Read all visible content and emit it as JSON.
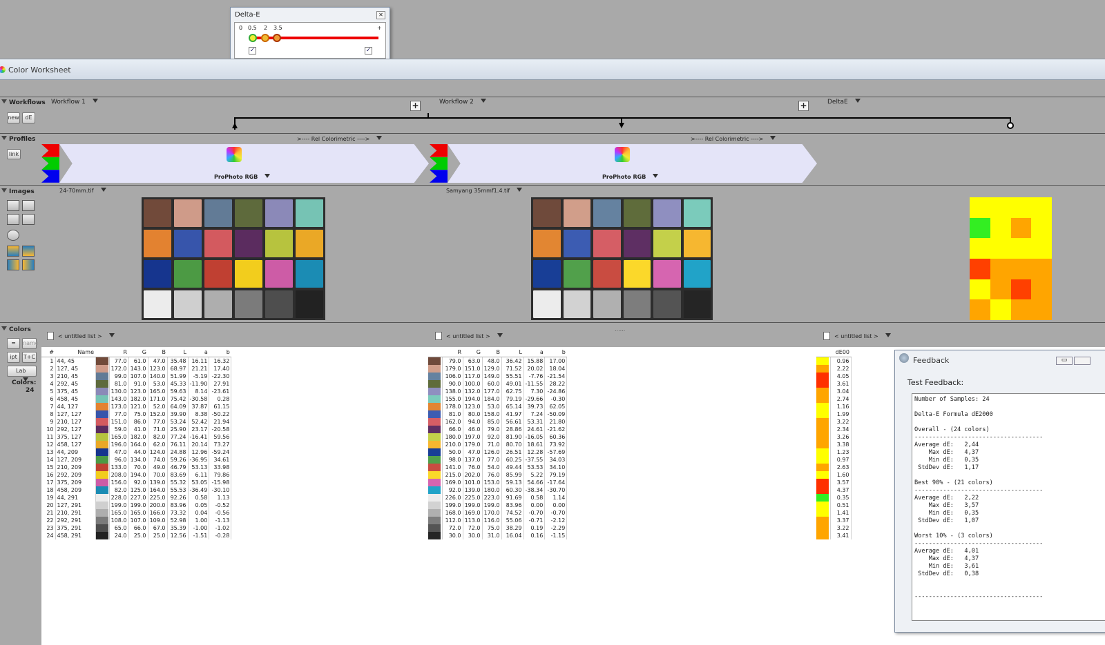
{
  "deltaE_window": {
    "title": "Delta-E",
    "scale": [
      "0",
      "0.5",
      "2",
      "3.5",
      "+"
    ],
    "check1": true,
    "check2": true
  },
  "window": {
    "title": "Color Worksheet"
  },
  "workflows": {
    "section": "Workflows",
    "new_label": "new",
    "de_label": "dE",
    "items": [
      {
        "label": "Workflow 1"
      },
      {
        "label": "Workflow 2"
      },
      {
        "label": "DeltaE"
      }
    ]
  },
  "profiles": {
    "section": "Profiles",
    "link_label": "link",
    "intents": [
      ">---- Rel Colorimetric ---->",
      ">---- Rel Colorimetric ---->"
    ],
    "names": [
      "ProPhoto RGB",
      "ProPhoto RGB"
    ]
  },
  "images": {
    "section": "Images",
    "files": [
      "24-70mm.tif",
      "Samyang 35mmf1.4.tif"
    ]
  },
  "colors": {
    "section": "Colors",
    "ipt_label": "ipt",
    "tc_label": "T+C",
    "lab_label": "Lab",
    "count_label": "Colors:",
    "count": "24",
    "list_names": [
      "< untitled list >",
      "< untitled list >",
      "< untitled list >"
    ],
    "headers1": [
      "#",
      "Name",
      "",
      "R",
      "G",
      "B",
      "L",
      "a",
      "b"
    ],
    "headers2": [
      "",
      "R",
      "G",
      "B",
      "L",
      "a",
      "b"
    ],
    "header3": "dE00",
    "rows1": [
      [
        "1",
        "44, 45",
        "#714a3a",
        "77.0",
        "61.0",
        "47.0",
        "35.48",
        "16.11",
        "16.32"
      ],
      [
        "2",
        "127, 45",
        "#cf9b89",
        "172.0",
        "143.0",
        "123.0",
        "68.97",
        "21.21",
        "17.40"
      ],
      [
        "3",
        "210, 45",
        "#627b96",
        "99.0",
        "107.0",
        "140.0",
        "51.99",
        "-5.19",
        "-22.30"
      ],
      [
        "4",
        "292, 45",
        "#5e6a3c",
        "81.0",
        "91.0",
        "53.0",
        "45.33",
        "-11.90",
        "27.91"
      ],
      [
        "5",
        "375, 45",
        "#8b89b8",
        "130.0",
        "123.0",
        "165.0",
        "59.63",
        "8.14",
        "-23.61"
      ],
      [
        "6",
        "458, 45",
        "#76c3b4",
        "143.0",
        "182.0",
        "171.0",
        "75.42",
        "-30.58",
        "0.28"
      ],
      [
        "7",
        "44, 127",
        "#e38230",
        "173.0",
        "121.0",
        "52.0",
        "64.09",
        "37.87",
        "61.15"
      ],
      [
        "8",
        "127, 127",
        "#3755ab",
        "77.0",
        "75.0",
        "152.0",
        "39.90",
        "8.38",
        "-50.22"
      ],
      [
        "9",
        "210, 127",
        "#d35a5f",
        "151.0",
        "86.0",
        "77.0",
        "53.24",
        "52.42",
        "21.94"
      ],
      [
        "10",
        "292, 127",
        "#5b2c5f",
        "59.0",
        "41.0",
        "71.0",
        "25.90",
        "23.17",
        "-20.58"
      ],
      [
        "11",
        "375, 127",
        "#b7c33e",
        "165.0",
        "182.0",
        "82.0",
        "77.24",
        "-16.41",
        "59.56"
      ],
      [
        "12",
        "458, 127",
        "#eaa826",
        "196.0",
        "164.0",
        "62.0",
        "76.11",
        "20.14",
        "73.27"
      ],
      [
        "13",
        "44, 209",
        "#16358e",
        "47.0",
        "44.0",
        "124.0",
        "24.88",
        "12.96",
        "-59.24"
      ],
      [
        "14",
        "127, 209",
        "#4c9a44",
        "96.0",
        "134.0",
        "74.0",
        "59.26",
        "-36.95",
        "34.61"
      ],
      [
        "15",
        "210, 209",
        "#c04032",
        "133.0",
        "70.0",
        "49.0",
        "46.79",
        "53.13",
        "33.98"
      ],
      [
        "16",
        "292, 209",
        "#f2cd1d",
        "208.0",
        "194.0",
        "70.0",
        "83.69",
        "6.11",
        "79.86"
      ],
      [
        "17",
        "375, 209",
        "#cd5ca6",
        "156.0",
        "92.0",
        "139.0",
        "55.32",
        "53.05",
        "-15.98"
      ],
      [
        "18",
        "458, 209",
        "#1b8cb4",
        "82.0",
        "125.0",
        "164.0",
        "55.53",
        "-36.49",
        "-30.10"
      ],
      [
        "19",
        "44, 291",
        "#ececec",
        "228.0",
        "227.0",
        "225.0",
        "92.26",
        "0.58",
        "1.13"
      ],
      [
        "20",
        "127, 291",
        "#cfcfcf",
        "199.0",
        "199.0",
        "200.0",
        "83.96",
        "0.05",
        "-0.52"
      ],
      [
        "21",
        "210, 291",
        "#aeaeae",
        "165.0",
        "165.0",
        "166.0",
        "73.32",
        "0.04",
        "-0.56"
      ],
      [
        "22",
        "292, 291",
        "#7b7b7b",
        "108.0",
        "107.0",
        "109.0",
        "52.98",
        "1.00",
        "-1.13"
      ],
      [
        "23",
        "375, 291",
        "#4e4e4e",
        "65.0",
        "66.0",
        "67.0",
        "35.39",
        "-1.00",
        "-1.02"
      ],
      [
        "24",
        "458, 291",
        "#222222",
        "24.0",
        "25.0",
        "25.0",
        "12.56",
        "-1.51",
        "-0.28"
      ]
    ],
    "rows2": [
      [
        "#6f4a3b",
        "79.0",
        "63.0",
        "48.0",
        "36.42",
        "15.88",
        "17.00"
      ],
      [
        "#d19e8a",
        "179.0",
        "151.0",
        "129.0",
        "71.52",
        "20.02",
        "18.04"
      ],
      [
        "#6582a0",
        "106.0",
        "117.0",
        "149.0",
        "55.51",
        "-7.76",
        "-21.54"
      ],
      [
        "#5f6c3b",
        "90.0",
        "100.0",
        "60.0",
        "49.01",
        "-11.55",
        "28.22"
      ],
      [
        "#8f8fc0",
        "138.0",
        "132.0",
        "177.0",
        "62.75",
        "7.30",
        "-24.86"
      ],
      [
        "#7bcbbb",
        "155.0",
        "194.0",
        "184.0",
        "79.19",
        "-29.66",
        "-0.30"
      ],
      [
        "#e28632",
        "178.0",
        "123.0",
        "53.0",
        "65.14",
        "39.73",
        "62.05"
      ],
      [
        "#3c5cb2",
        "81.0",
        "80.0",
        "158.0",
        "41.97",
        "7.24",
        "-50.09"
      ],
      [
        "#d55e65",
        "162.0",
        "94.0",
        "85.0",
        "56.61",
        "53.31",
        "21.80"
      ],
      [
        "#5e2f63",
        "66.0",
        "46.0",
        "79.0",
        "28.86",
        "24.61",
        "-21.62"
      ],
      [
        "#c4d04a",
        "180.0",
        "197.0",
        "92.0",
        "81.90",
        "-16.05",
        "60.36"
      ],
      [
        "#f6b730",
        "210.0",
        "179.0",
        "71.0",
        "80.70",
        "18.61",
        "73.92"
      ],
      [
        "#183e96",
        "50.0",
        "47.0",
        "126.0",
        "26.51",
        "12.28",
        "-57.69"
      ],
      [
        "#51a04b",
        "98.0",
        "137.0",
        "77.0",
        "60.25",
        "-37.55",
        "34.03"
      ],
      [
        "#c94c41",
        "141.0",
        "76.0",
        "54.0",
        "49.44",
        "53.53",
        "34.10"
      ],
      [
        "#fbd82a",
        "215.0",
        "202.0",
        "76.0",
        "85.99",
        "5.22",
        "79.19"
      ],
      [
        "#d665b0",
        "169.0",
        "101.0",
        "153.0",
        "59.13",
        "54.66",
        "-17.64"
      ],
      [
        "#21a3c8",
        "92.0",
        "139.0",
        "180.0",
        "60.30",
        "-38.34",
        "-30.70"
      ],
      [
        "#ececec",
        "226.0",
        "225.0",
        "223.0",
        "91.69",
        "0.58",
        "1.14"
      ],
      [
        "#d2d2d2",
        "199.0",
        "199.0",
        "199.0",
        "83.96",
        "0.00",
        "0.00"
      ],
      [
        "#b0b0b0",
        "168.0",
        "169.0",
        "170.0",
        "74.52",
        "-0.70",
        "-0.70"
      ],
      [
        "#7d7d7d",
        "112.0",
        "113.0",
        "116.0",
        "55.06",
        "-0.71",
        "-2.12"
      ],
      [
        "#545454",
        "72.0",
        "72.0",
        "75.0",
        "38.29",
        "0.19",
        "-2.29"
      ],
      [
        "#252525",
        "30.0",
        "30.0",
        "31.0",
        "16.04",
        "0.16",
        "-1.15"
      ]
    ],
    "de": [
      [
        "#ffff00",
        "0.96"
      ],
      [
        "#ffa500",
        "2.22"
      ],
      [
        "#ff3000",
        "4.05"
      ],
      [
        "#ff3000",
        "3.61"
      ],
      [
        "#ffa500",
        "3.04"
      ],
      [
        "#ffa500",
        "2.74"
      ],
      [
        "#ffff00",
        "1.16"
      ],
      [
        "#ffff00",
        "1.99"
      ],
      [
        "#ffa500",
        "3.22"
      ],
      [
        "#ffa500",
        "2.34"
      ],
      [
        "#ffa500",
        "3.26"
      ],
      [
        "#ffa500",
        "3.38"
      ],
      [
        "#ffff00",
        "1.23"
      ],
      [
        "#ffff00",
        "0.97"
      ],
      [
        "#ffa500",
        "2.63"
      ],
      [
        "#ffff00",
        "1.60"
      ],
      [
        "#ff3000",
        "3.57"
      ],
      [
        "#ff3000",
        "4.37"
      ],
      [
        "#33ee22",
        "0.35"
      ],
      [
        "#ffff00",
        "0.51"
      ],
      [
        "#ffff00",
        "1.41"
      ],
      [
        "#ffa500",
        "3.37"
      ],
      [
        "#ffa500",
        "3.22"
      ],
      [
        "#ffa500",
        "3.41"
      ]
    ]
  },
  "heatmap": [
    "#ffff00",
    "#ffff00",
    "#ffff00",
    "#ffff00",
    "#33ee22",
    "#ffff00",
    "#ffa500",
    "#ffff00",
    "#ffff00",
    "#ffff00",
    "#ffff00",
    "#ffff00",
    "#ff4000",
    "#ffa500",
    "#ffa500",
    "#ffa500",
    "#ffff00",
    "#ffa500",
    "#ff4000",
    "#ffa500",
    "#ffa500",
    "#ffff00",
    "#ffa500",
    "#ffa500",
    "#ffa500",
    "#ffa500",
    "#ffa500",
    "#ff4000",
    "#ffa500",
    "#ffa500",
    "#ffa500",
    "#ffa500",
    "#ffa500",
    "#ff4000",
    "#ffa500",
    "#ffa500"
  ],
  "chart1": [
    "#714a3a",
    "#cf9b89",
    "#627b96",
    "#5e6a3c",
    "#8b89b8",
    "#76c3b4",
    "#e38230",
    "#3755ab",
    "#d35a5f",
    "#5b2c5f",
    "#b7c33e",
    "#eaa826",
    "#16358e",
    "#4c9a44",
    "#c04032",
    "#f2cd1d",
    "#cd5ca6",
    "#1b8cb4",
    "#ececec",
    "#cfcfcf",
    "#aeaeae",
    "#7b7b7b",
    "#4e4e4e",
    "#222222"
  ],
  "chart2": [
    "#6f4a3b",
    "#d19e8a",
    "#6582a0",
    "#5f6c3b",
    "#8f8fc0",
    "#7bcbbb",
    "#e28632",
    "#3c5cb2",
    "#d55e65",
    "#5e2f63",
    "#c4d04a",
    "#f6b730",
    "#183e96",
    "#51a04b",
    "#c94c41",
    "#fbd82a",
    "#d665b0",
    "#21a3c8",
    "#ececec",
    "#d2d2d2",
    "#b0b0b0",
    "#7d7d7d",
    "#545454",
    "#252525"
  ],
  "feedback": {
    "title": "Feedback",
    "subtitle": "Test Feedback:",
    "lines": [
      "Number of Samples: 24",
      "",
      "Delta-E Formula dE2000",
      "",
      "Overall - (24 colors)",
      "------------------------------------",
      "Average dE:   2,44",
      "    Max dE:   4,37",
      "    Min dE:   0,35",
      " StdDev dE:   1,17",
      "",
      "Best 90% - (21 colors)",
      "------------------------------------",
      "Average dE:   2,22",
      "    Max dE:   3,57",
      "    Min dE:   0,35",
      " StdDev dE:   1,07",
      "",
      "Worst 10% - (3 colors)",
      "------------------------------------",
      "Average dE:   4,01",
      "    Max dE:   4,37",
      "    Min dE:   3,61",
      " StdDev dE:   0,38",
      "",
      "",
      "------------------------------------"
    ]
  }
}
